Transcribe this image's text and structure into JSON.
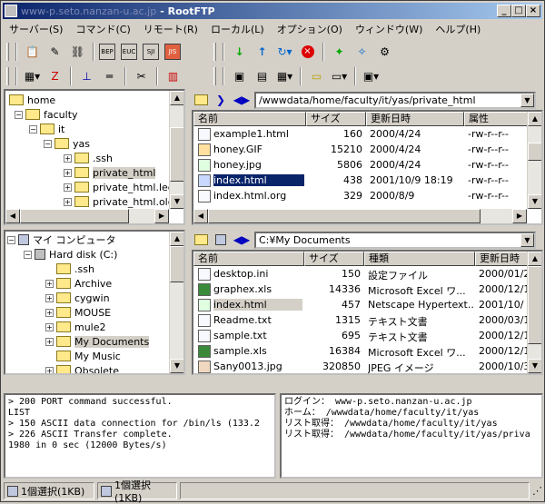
{
  "window": {
    "url": "www-p.seto.nanzan-u.ac.jp",
    "title": "RootFTP",
    "min_label": "_",
    "max_label": "□",
    "close_label": "×"
  },
  "menu": [
    "サーバー(S)",
    "コマンド(C)",
    "リモート(R)",
    "ローカル(L)",
    "オプション(O)",
    "ウィンドウ(W)",
    "ヘルプ(H)"
  ],
  "remote_tree": {
    "items": [
      "home",
      "faculty",
      "it",
      "yas",
      ".ssh",
      "private_html",
      "private_html.lec",
      "private_html.old"
    ],
    "selected": "private_html"
  },
  "remote_path": "/wwwdata/home/faculty/it/yas/private_html",
  "remote_columns": [
    "名前",
    "サイズ",
    "更新日時",
    "属性"
  ],
  "remote_files": [
    {
      "name": "example1.html",
      "size": "160",
      "date": "2000/4/24",
      "attr": "-rw-r--r--"
    },
    {
      "name": "honey.GIF",
      "size": "15210",
      "date": "2000/4/24",
      "attr": "-rw-r--r--"
    },
    {
      "name": "honey.jpg",
      "size": "5806",
      "date": "2000/4/24",
      "attr": "-rw-r--r--"
    },
    {
      "name": "index.html",
      "size": "438",
      "date": "2001/10/9 18:19",
      "attr": "-rw-r--r--"
    },
    {
      "name": "index.html.org",
      "size": "329",
      "date": "2000/8/9",
      "attr": "-rw-r--r--"
    }
  ],
  "local_tree": {
    "items": [
      "マイ コンピュータ",
      "Hard disk (C:)",
      ".ssh",
      "Archive",
      "cygwin",
      "MOUSE",
      "mule2",
      "My Documents",
      "My Music",
      "Obsolete"
    ],
    "selected": "My Documents"
  },
  "local_path": "C:¥My Documents",
  "local_columns": [
    "名前",
    "サイズ",
    "種類",
    "更新日時"
  ],
  "local_files": [
    {
      "name": "desktop.ini",
      "size": "150",
      "type": "設定ファイル",
      "date": "2000/01/2"
    },
    {
      "name": "graphex.xls",
      "size": "14336",
      "type": "Microsoft Excel ワ...",
      "date": "2000/12/1"
    },
    {
      "name": "index.html",
      "size": "457",
      "type": "Netscape Hypertext...",
      "date": "2001/10/"
    },
    {
      "name": "Readme.txt",
      "size": "1315",
      "type": "テキスト文書",
      "date": "2000/03/1"
    },
    {
      "name": "sample.txt",
      "size": "695",
      "type": "テキスト文書",
      "date": "2000/12/1"
    },
    {
      "name": "sample.xls",
      "size": "16384",
      "type": "Microsoft Excel ワ...",
      "date": "2000/12/1"
    },
    {
      "name": "Sany0013.jpg",
      "size": "320850",
      "type": "JPEG イメージ",
      "date": "2000/10/3"
    }
  ],
  "log_left": "> 200 PORT command successful.\nLIST\n> 150 ASCII data connection for /bin/ls (133.2\n> 226 ASCII Transfer complete.\n1980 in 0 sec (12000 Bytes/s)",
  "log_right": "ログイン： www-p.seto.nanzan-u.ac.jp\nホーム： /wwwdata/home/faculty/it/yas\nリスト取得： /wwwdata/home/faculty/it/yas\nリスト取得： /wwwdata/home/faculty/it/yas/priva",
  "status": [
    "1個選択(1KB)",
    "1個選択(1KB)"
  ],
  "icons": {
    "toolbar_left_row1": [
      "properties-icon",
      "edit-icon",
      "link-icon",
      "bep-icon",
      "euc-icon",
      "sjis-icon",
      "jis-icon"
    ],
    "toolbar_right_row1": [
      "download-icon",
      "upload-icon",
      "refresh-icon",
      "stop-icon",
      "star-icon",
      "star2-icon",
      "settings-icon"
    ],
    "accent_titlebar": "#0a246a"
  }
}
